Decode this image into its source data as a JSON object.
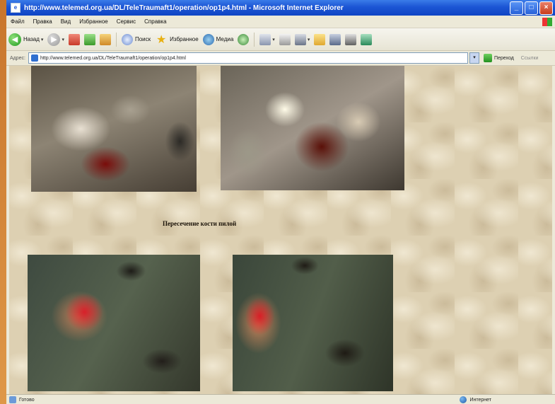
{
  "window": {
    "title": "http://www.telemed.org.ua/DL/TeleTraumaft1/operation/op1p4.html - Microsoft Internet Explorer"
  },
  "menu": [
    "Файл",
    "Правка",
    "Вид",
    "Избранное",
    "Сервис",
    "Справка"
  ],
  "toolbar": {
    "back_label": "Назад",
    "search_label": "Поиск",
    "favorites_label": "Избранное",
    "media_label": "Медиа"
  },
  "address": {
    "label": "Адрес:",
    "url": "http://www.telemed.org.ua/DL/TeleTraumaft1/operation/op1p4.html",
    "go_label": "Переход",
    "links_label": "Ссылки"
  },
  "content": {
    "caption": "Пересечение кости пилой"
  },
  "status": {
    "text": "Готово",
    "zone": "Интернет"
  },
  "colors": {
    "titlebar": "#1c55d4",
    "page_background": "#ddd0b2"
  }
}
